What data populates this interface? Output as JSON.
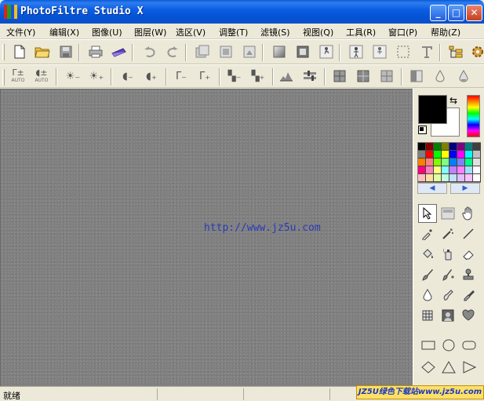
{
  "window": {
    "title": "PhotoFiltre Studio X",
    "minimize": "_",
    "maximize": "□",
    "close": "✕"
  },
  "menu": [
    "文件(Y)",
    "编辑(X)",
    "图像(U)",
    "图层(W)",
    "选区(V)",
    "调整(T)",
    "滤镜(S)",
    "视图(Q)",
    "工具(R)",
    "窗口(P)",
    "帮助(Z)"
  ],
  "toolbar2": {
    "auto_label_1": "AUTO",
    "auto_label_2": "AUTO"
  },
  "canvas": {
    "watermark": "http://www.jz5u.com"
  },
  "palette": {
    "foreground": "#000000",
    "background": "#ffffff",
    "prev": "◀",
    "next": "▶",
    "colors": [
      "#000000",
      "#800000",
      "#008000",
      "#808000",
      "#000080",
      "#800080",
      "#008080",
      "#404040",
      "#808080",
      "#ff0000",
      "#00ff00",
      "#ffff00",
      "#0000ff",
      "#ff00ff",
      "#00ffff",
      "#c0c0c0",
      "#ff8000",
      "#ff8080",
      "#80ff00",
      "#80ff80",
      "#0080ff",
      "#8080ff",
      "#00ff80",
      "#e0e0e0",
      "#ff0080",
      "#ff80c0",
      "#ffff80",
      "#80ffff",
      "#c080ff",
      "#ff80ff",
      "#a0e0ff",
      "#ffffff",
      "#ffc0c0",
      "#ffe0a0",
      "#e0ffa0",
      "#c0ffe0",
      "#c0e0ff",
      "#e0c0ff",
      "#ffc0ff",
      "#ffffff"
    ]
  },
  "status": {
    "text": "就绪"
  },
  "badge": {
    "text": "JZ5U绿色下载站www.jz5u.com"
  }
}
